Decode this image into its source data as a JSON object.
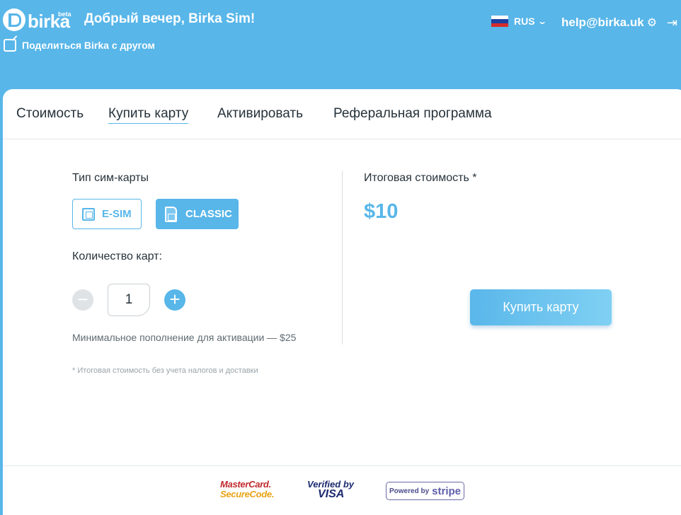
{
  "header": {
    "logo_text": "birka",
    "logo_badge": "beta",
    "greeting": "Добрый вечер, Birka Sim!",
    "share_label": "Поделиться Birka с другом",
    "language": "RUS",
    "help_email": "help@birka.uk"
  },
  "tabs": [
    {
      "label": "Стоимость"
    },
    {
      "label": "Купить карту",
      "active": true
    },
    {
      "label": "Активировать"
    },
    {
      "label": "Реферальная программа"
    }
  ],
  "form": {
    "sim_type_label": "Тип сим-карты",
    "sim_options": [
      {
        "label": "E-SIM",
        "selected": false
      },
      {
        "label": "CLASSIC",
        "selected": true
      }
    ],
    "quantity_label": "Количество карт:",
    "quantity_value": "1",
    "min_topup_text": "Минимальное пополнение для активации — $25",
    "footnote": "* Итоговая стоимость без учета налогов и доставки"
  },
  "summary": {
    "total_label": "Итоговая стоимость *",
    "total_value": "$10",
    "buy_button": "Купить карту"
  },
  "footer": {
    "mastercard_line1": "MasterCard.",
    "mastercard_line2": "SecureCode.",
    "visa_line1": "Verified by",
    "visa_line2": "VISA",
    "stripe_line1": "Powered by",
    "stripe_line2": "stripe"
  },
  "colors": {
    "accent": "#58b6e9",
    "text": "#26323a",
    "muted": "#9aa4aa"
  }
}
